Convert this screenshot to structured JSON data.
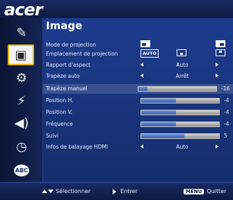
{
  "brand": {
    "logo_text": "acer"
  },
  "sidebar": {
    "items": [
      {
        "name": "color-icon",
        "glyph": "✎"
      },
      {
        "name": "image-icon",
        "glyph": "▣",
        "active": true
      },
      {
        "name": "settings-icon",
        "glyph": "⚙"
      },
      {
        "name": "management-icon",
        "glyph": "⚡"
      },
      {
        "name": "audio-icon",
        "glyph": "◀))"
      },
      {
        "name": "timer-icon",
        "glyph": "◷"
      },
      {
        "name": "language-icon",
        "glyph": "ABC"
      }
    ]
  },
  "panel": {
    "title": "Image",
    "rows": {
      "mode_projection": {
        "label": "Mode de projection"
      },
      "emplacement": {
        "label": "Emplacement de projection",
        "auto_tag": "AUTO"
      },
      "rapport": {
        "label": "Rapport d'aspect",
        "value": "Auto"
      },
      "trapeze_auto": {
        "label": "Trapèze auto",
        "value": "Arrêt"
      },
      "trapeze_manuel": {
        "label": "Trapèze manuel",
        "value": "-16",
        "level": 0.12
      },
      "position_h": {
        "label": "Position H.",
        "value": "-4",
        "level": 0.45
      },
      "position_v": {
        "label": "Position V.",
        "value": "-4",
        "level": 0.45
      },
      "frequence": {
        "label": "Fréquence",
        "value": "-4",
        "level": 0.45
      },
      "suivi": {
        "label": "Suivi",
        "value": "5",
        "level": 0.55
      },
      "hdmi": {
        "label": "Infos de balayage HDMI",
        "value": "Auto"
      }
    }
  },
  "footer": {
    "select_label": "Sélectionner",
    "enter_label": "Entrer",
    "menu_key": "MENU",
    "quit_label": "Quitter"
  },
  "colors": {
    "accent": "#e6b800",
    "panel": "#1a3680",
    "background": "#0d1a3a"
  }
}
